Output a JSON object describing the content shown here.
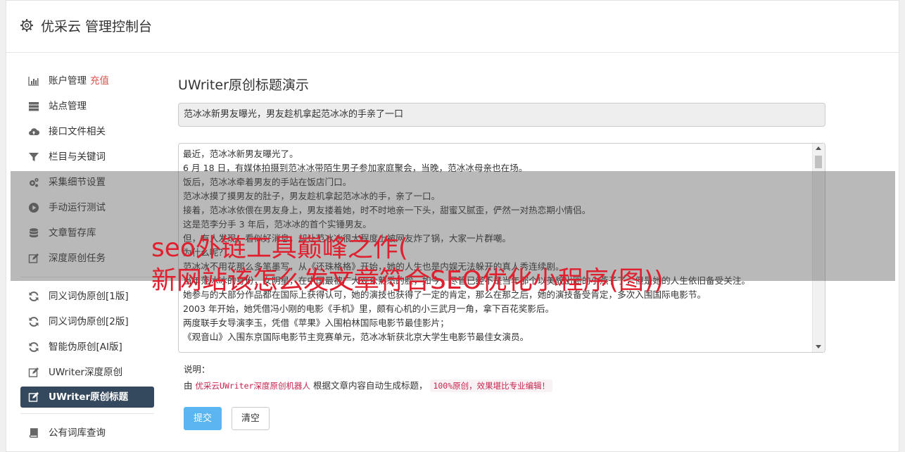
{
  "header": {
    "title": "优采云 管理控制台"
  },
  "sidebar": {
    "group1": [
      {
        "label": "账户管理",
        "badge": "充值",
        "icon": "bar-chart-icon"
      },
      {
        "label": "站点管理",
        "icon": "server-icon"
      },
      {
        "label": "接口文件相关",
        "icon": "cloud-upload-icon"
      },
      {
        "label": "栏目与关键词",
        "icon": "filter-icon"
      },
      {
        "label": "采集细节设置",
        "icon": "gears-icon"
      },
      {
        "label": "手动运行测试",
        "icon": "play-circle-icon"
      },
      {
        "label": "文章暂存库",
        "icon": "database-icon"
      },
      {
        "label": "深度原创任务",
        "icon": "edit-icon"
      }
    ],
    "group2": [
      {
        "label": "同义词伪原创[1版]",
        "icon": "refresh-icon"
      },
      {
        "label": "同义词伪原创[2版]",
        "icon": "refresh-icon"
      },
      {
        "label": "智能伪原创[AI版]",
        "icon": "refresh-icon"
      },
      {
        "label": "UWriter深度原创",
        "icon": "edit-icon"
      },
      {
        "label": "UWriter原创标题",
        "icon": "edit-icon"
      }
    ],
    "group3": [
      {
        "label": "公有词库查询",
        "icon": "book-icon"
      }
    ]
  },
  "main": {
    "page_title": "UWriter原创标题演示",
    "title_value": "范冰冰新男友曝光，男友趁机拿起范冰冰的手亲了一口",
    "content_lines": [
      "最近，范冰冰新男友曝光了。",
      "6 月 18 日，有媒体拍摄到范冰冰带陌生男子参加家庭聚会，当晚，范冰冰母亲也在场。",
      "饭后，范冰冰牵着男友的手站在饭店门口。",
      "范冰冰摸了摸男友的肚子，男友趁机拿起范冰冰的手，亲了一口。",
      "接着，范冰冰依偎在男友身上，男友搂着她，时不时地亲一下头，甜蜜又腻歪，俨然一对热恋期小情侣。",
      "这是范李分手 3 年后，范冰冰的首个实锤男友。",
      "但，有人发现，看似好消息，却让范冰冰很大程度上被网友炸了锅，大家一片群嘲。",
      "为什么呢？",
      "范冰冰不用花那么多笔墨写，从《还珠格格》开始，她的人生也是内娱无法躲开的真人秀连续剧。",
      "当年范冰冰的身份，女明星，在中国最被广大观众熟悉的脸，如今，尽管已经不是当年那个以美貌出圈的小燕子了，但是她的人生依旧备受关注。",
      "她参与的大部分作品都在国际上获得认可，她的演技也获得了一定的肯定，那么在那之后，她的演技备受肯定，多次入围国际电影节。",
      "2003 年开始，她凭借冯小刚的电影《手机》里，颇有心机的小三武月一角，拿下百花奖影后。",
      "两度联手女导演李玉，凭借《苹果》入围柏林国际电影节最佳影片；",
      "《观音山》入围东京国际电影节主竞赛单元，范冰冰斩获北京大学生电影节最佳女演员。"
    ],
    "note_label": "说明：",
    "note_prefix": "由",
    "note_robot": "优采云UWriter深度原创机器人",
    "note_mid": "根据文章内容自动生成标题，",
    "note_code": "100%原创，效果堪比专业编辑！",
    "submit_label": "提交",
    "clear_label": "清空"
  },
  "overlay": {
    "line1": "seo外链工具巅峰之作(",
    "line2": "新网站该怎么发文章符合SEO优化小程序(图))"
  },
  "colors": {
    "active_nav_bg": "#34495e",
    "submit_bg": "#5bb5f0",
    "badge": "#d9534f",
    "overlay_text": "#e0202f",
    "code_text": "#c7254e"
  }
}
